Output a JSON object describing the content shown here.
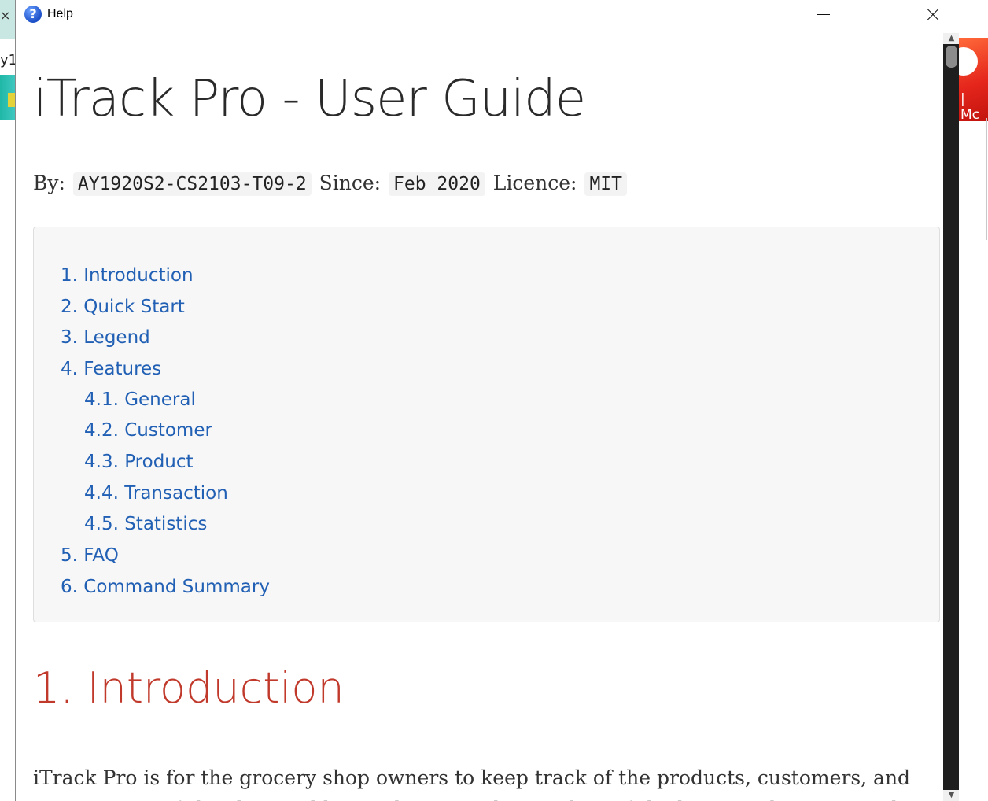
{
  "background_app": {
    "left_close_glyph": "×",
    "left_text": "y1",
    "right_text": "| Mc"
  },
  "window": {
    "title": "Help",
    "icon": "help-question-icon",
    "controls": {
      "minimize_icon": "minimize-icon",
      "maximize_icon": "maximize-icon",
      "close_icon": "close-icon"
    }
  },
  "doc": {
    "title": "iTrack Pro - User Guide",
    "byline": {
      "by_label": "By:",
      "by_value": "AY1920S2-CS2103-T09-2",
      "since_label": "Since:",
      "since_value": "Feb 2020",
      "licence_label": "Licence:",
      "licence_value": "MIT"
    },
    "toc": [
      {
        "label": "1. Introduction",
        "level": 1
      },
      {
        "label": "2. Quick Start",
        "level": 1
      },
      {
        "label": "3. Legend",
        "level": 1
      },
      {
        "label": "4. Features",
        "level": 1
      },
      {
        "label": "4.1. General",
        "level": 2
      },
      {
        "label": "4.2. Customer",
        "level": 2
      },
      {
        "label": "4.3. Product",
        "level": 2
      },
      {
        "label": "4.4. Transaction",
        "level": 2
      },
      {
        "label": "4.5. Statistics",
        "level": 2
      },
      {
        "label": "5. FAQ",
        "level": 1
      },
      {
        "label": "6. Command Summary",
        "level": 1
      }
    ],
    "intro_heading": "1. Introduction",
    "intro_text": "iTrack Pro is for the grocery shop owners to keep track of the products, customers, and transactions of the shop and have a better understanding of the business by viewing the"
  },
  "colors": {
    "link": "#2160b4",
    "heading_red": "#c0392b",
    "toc_background": "#f7f7f7"
  }
}
